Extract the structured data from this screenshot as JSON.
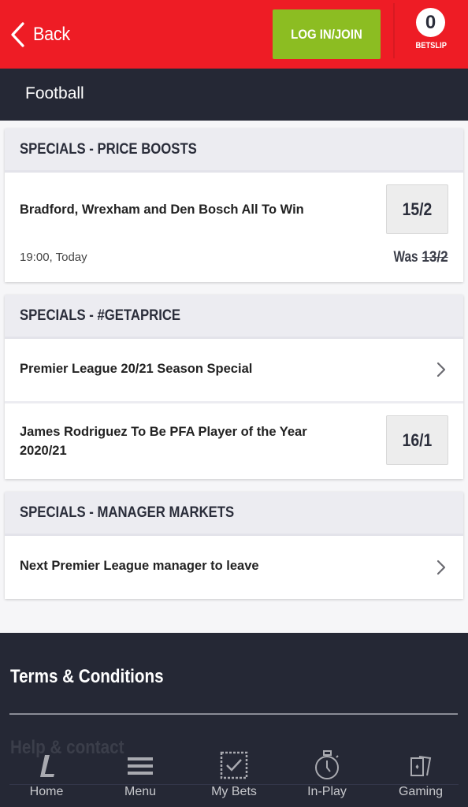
{
  "header": {
    "back_label": "Back",
    "login_label": "LOG IN/JOIN",
    "betslip_count": "0",
    "betslip_label": "BETSLIP",
    "colors": {
      "brand_red": "#ee1c25",
      "login_green": "#8cbd22",
      "dark": "#252835"
    }
  },
  "subheader": {
    "title": "Football"
  },
  "sections": [
    {
      "title": "SPECIALS - PRICE BOOSTS",
      "rows": [
        {
          "name": "Bradford, Wrexham and Den Bosch All To Win",
          "odds": "15/2",
          "time": "19:00, Today",
          "was_label": "Was",
          "was_odds": "13/2"
        }
      ]
    },
    {
      "title": "SPECIALS - #GETAPRICE",
      "rows": [
        {
          "name": "Premier League 20/21 Season Special",
          "icon": "chevron-right-icon"
        },
        {
          "name_line1": "James Rodriguez To Be PFA Player of the Year",
          "name_line2": "2020/21",
          "odds": "16/1"
        }
      ]
    },
    {
      "title": "SPECIALS - MANAGER MARKETS",
      "rows": [
        {
          "name": "Next Premier League manager to leave",
          "icon": "chevron-right-icon"
        }
      ]
    }
  ],
  "footer": {
    "terms_label": "Terms & Conditions",
    "help_label": "Help & contact"
  },
  "bottom_nav": [
    {
      "label": "Home",
      "icon": "home-logo-icon"
    },
    {
      "label": "Menu",
      "icon": "hamburger-menu-icon"
    },
    {
      "label": "My Bets",
      "icon": "my-bets-check-icon"
    },
    {
      "label": "In-Play",
      "icon": "stopwatch-icon"
    },
    {
      "label": "Gaming",
      "icon": "cards-icon"
    }
  ]
}
